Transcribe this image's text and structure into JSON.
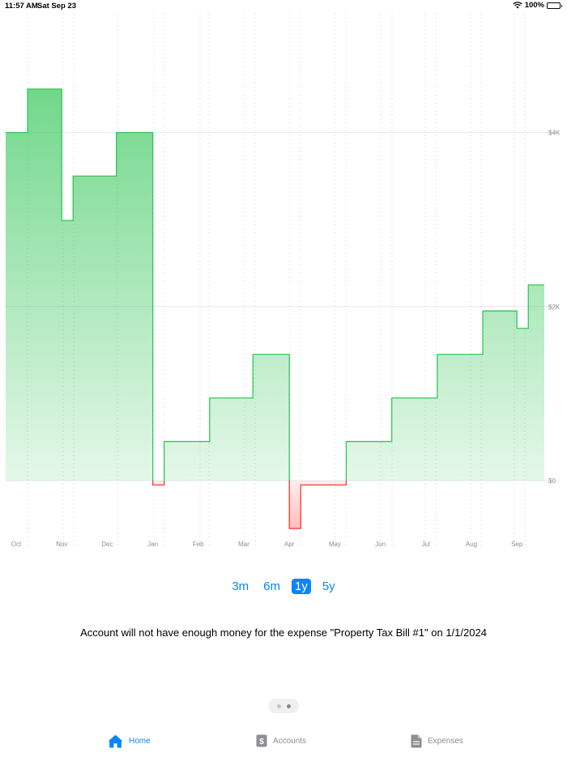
{
  "status_bar": {
    "time": "11:57 AM",
    "date": "Sat Sep 23",
    "battery": "100%",
    "icons": [
      "wifi-icon",
      "battery-icon"
    ]
  },
  "chart_data": {
    "type": "area",
    "style": "step",
    "x_tick_labels": [
      "Oct",
      "Nov",
      "Dec",
      "Jan",
      "Feb",
      "Mar",
      "Apr",
      "May",
      "Jun",
      "Jul",
      "Aug",
      "Sep"
    ],
    "y_tick_labels": [
      "$4K",
      "$2K",
      "$0"
    ],
    "y_ticks": [
      4000,
      2000,
      0
    ],
    "ylim": [
      -600,
      5500
    ],
    "xlim": [
      0,
      11.6
    ],
    "grid": {
      "horizontal": true,
      "vertical": "dashed"
    },
    "colors": {
      "positive": "#34c759",
      "negative": "#ff3b30"
    },
    "series": [
      {
        "points": [
          [
            0,
            4000
          ],
          [
            0.25,
            4500
          ],
          [
            1.0,
            2990
          ],
          [
            1.25,
            3500
          ],
          [
            2.2,
            4000
          ],
          [
            3.0,
            -50
          ],
          [
            3.25,
            450
          ],
          [
            4.25,
            950
          ],
          [
            5.2,
            1450
          ],
          [
            6.0,
            -550
          ],
          [
            6.25,
            -50
          ],
          [
            7.25,
            450
          ],
          [
            8.25,
            950
          ],
          [
            9.25,
            1450
          ],
          [
            10.25,
            1950
          ],
          [
            11.0,
            1750
          ],
          [
            11.25,
            2250
          ],
          [
            11.6,
            2250
          ]
        ]
      }
    ]
  },
  "range_picker": {
    "options": [
      "3m",
      "6m",
      "1y",
      "5y"
    ],
    "selected": "1y"
  },
  "warning": "Account will not have enough money for the expense \"Property Tax Bill #1\" on 1/1/2024",
  "tabs": [
    {
      "label": "Home",
      "icon": "house-icon",
      "active": true
    },
    {
      "label": "Accounts",
      "icon": "dollar-doc-icon",
      "active": false
    },
    {
      "label": "Expenses",
      "icon": "doc-icon",
      "active": false
    }
  ]
}
